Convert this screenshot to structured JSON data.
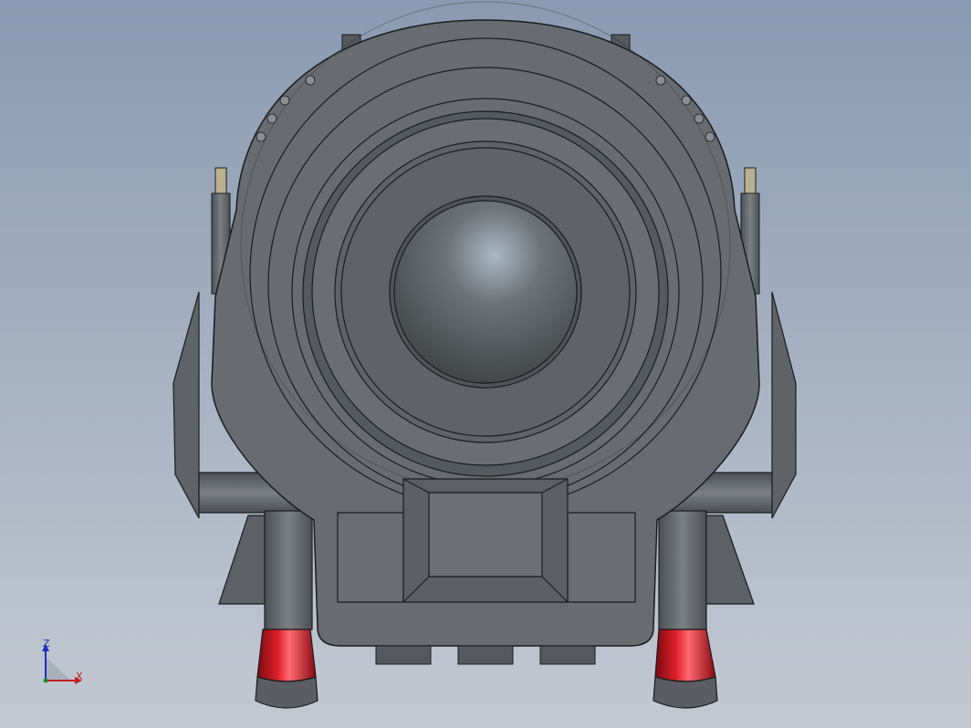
{
  "viewport": {
    "background_top": "#8a9ab2",
    "background_bottom": "#c3c9d2"
  },
  "model": {
    "body_color": "#6b6f72",
    "dark_color": "#4a4e52",
    "edge_color": "#1a1c1e",
    "accent_color": "#c8141e"
  },
  "triad": {
    "z_label": "Z",
    "x_label": "X",
    "z_color": "#1f2fc0",
    "x_color": "#c01f1f",
    "y_color": "#1a8a2a"
  }
}
